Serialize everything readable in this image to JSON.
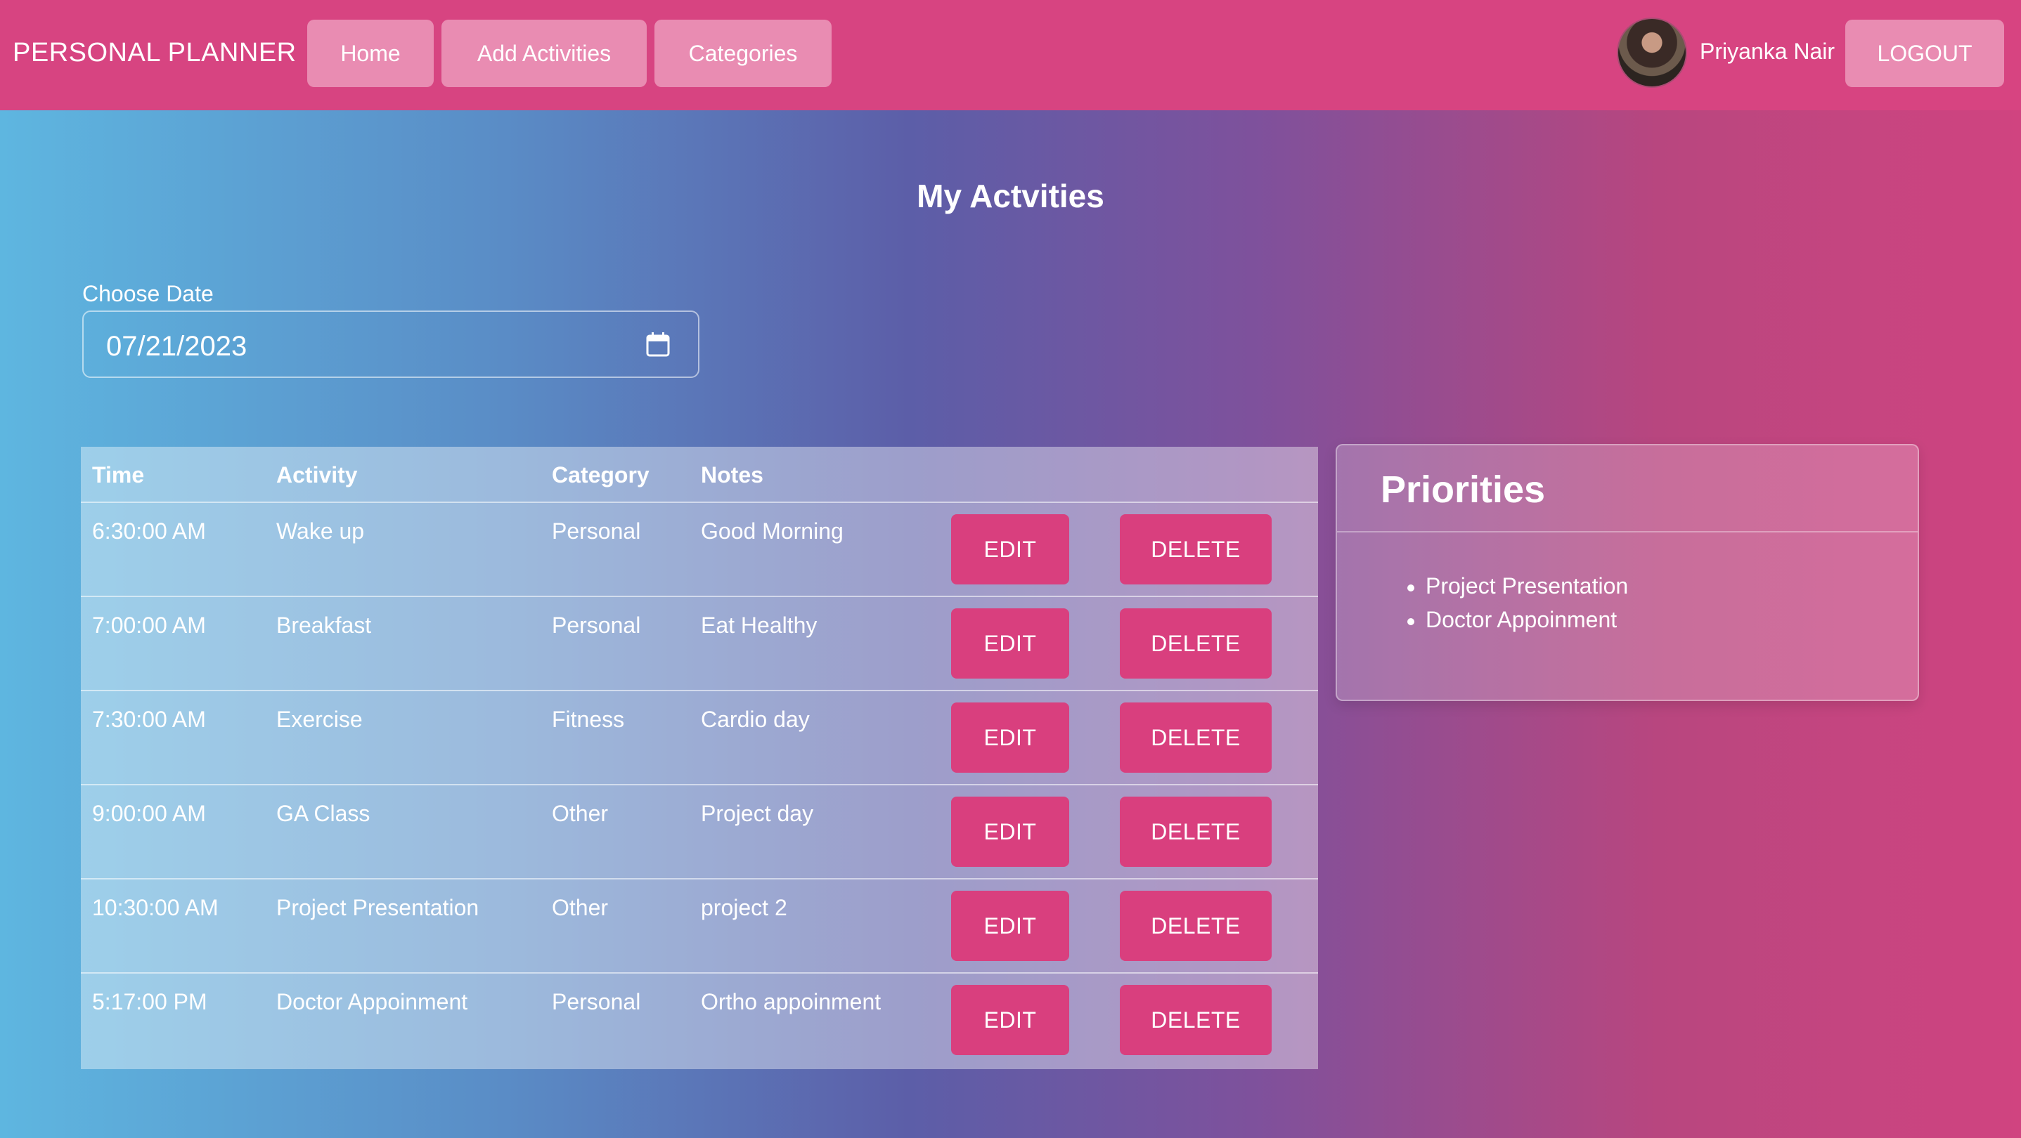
{
  "navbar": {
    "brand": "PERSONAL PLANNER",
    "links": [
      {
        "label": "Home"
      },
      {
        "label": "Add Activities"
      },
      {
        "label": "Categories"
      }
    ],
    "username": "Priyanka Nair",
    "logout_label": "LOGOUT"
  },
  "page": {
    "title": "My Actvities"
  },
  "date_picker": {
    "label": "Choose Date",
    "value": "07/21/2023",
    "icon": "calendar-icon"
  },
  "table": {
    "headers": {
      "time": "Time",
      "activity": "Activity",
      "category": "Category",
      "notes": "Notes"
    },
    "edit_label": "EDIT",
    "delete_label": "DELETE",
    "rows": [
      {
        "time": "6:30:00 AM",
        "activity": "Wake up",
        "category": "Personal",
        "notes": "Good Morning"
      },
      {
        "time": "7:00:00 AM",
        "activity": "Breakfast",
        "category": "Personal",
        "notes": "Eat Healthy"
      },
      {
        "time": "7:30:00 AM",
        "activity": "Exercise",
        "category": "Fitness",
        "notes": "Cardio day"
      },
      {
        "time": "9:00:00 AM",
        "activity": "GA Class",
        "category": "Other",
        "notes": "Project day"
      },
      {
        "time": "10:30:00 AM",
        "activity": "Project Presentation",
        "category": "Other",
        "notes": "project 2"
      },
      {
        "time": "5:17:00 PM",
        "activity": "Doctor Appoinment",
        "category": "Personal",
        "notes": "Ortho appoinment"
      }
    ]
  },
  "priorities": {
    "title": "Priorities",
    "items": [
      "Project Presentation",
      "Doctor Appoinment"
    ]
  },
  "colors": {
    "navbar": "#d74481",
    "nav_button": "#e98cb2",
    "action_button": "#d93f7e"
  }
}
